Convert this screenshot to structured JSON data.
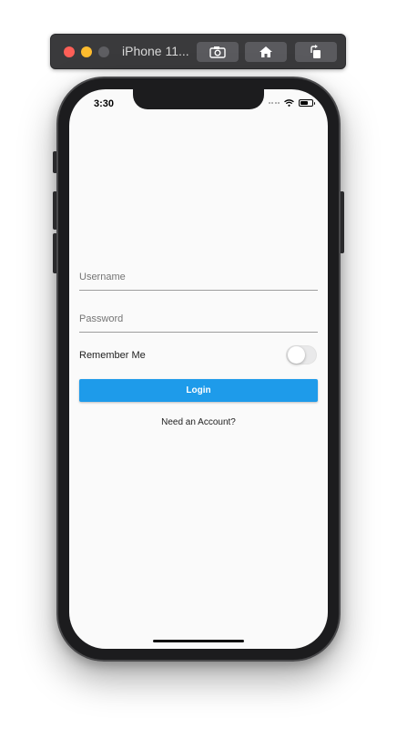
{
  "simulator": {
    "title": "iPhone 11...",
    "buttons": {
      "screenshot_icon": "camera-icon",
      "home_icon": "home-icon",
      "rotate_icon": "rotate-icon"
    }
  },
  "status_bar": {
    "time": "3:30",
    "icons": [
      "signal-dots-icon",
      "wifi-icon",
      "battery-icon"
    ],
    "battery_level": 0.7
  },
  "form": {
    "username": {
      "placeholder": "Username",
      "value": ""
    },
    "password": {
      "placeholder": "Password",
      "value": ""
    },
    "remember_me": {
      "label": "Remember Me",
      "checked": false
    },
    "login_button": {
      "label": "Login"
    },
    "account_link": {
      "label": "Need an Account?"
    }
  },
  "colors": {
    "primary": "#1e9bea",
    "screen_background": "#fafafa",
    "frame": "#1c1c1e",
    "text": "#212121"
  }
}
